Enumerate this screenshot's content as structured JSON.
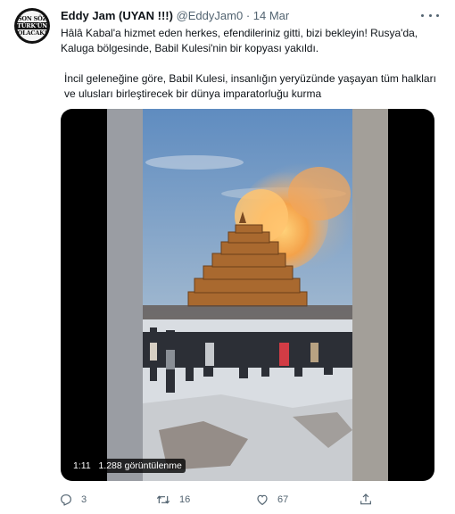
{
  "author": {
    "name": "Eddy Jam (UYAN !!!)",
    "handle": "@EddyJam0",
    "separator": "·",
    "date": "14 Mar",
    "avatar_text": [
      "SON SÖZ",
      "TÜRK'ÜN",
      "OLACAK!"
    ]
  },
  "tweet": {
    "paragraphs": [
      "Hâlâ Kabal'a hizmet eden herkes, efendileriniz gitti, bizi bekleyin! Rusya'da, Kaluga bölgesinde, Babil Kulesi'nin bir kopyası yakıldı.",
      "İncil geleneğine göre, Babil Kulesi, insanlığın yeryüzünde yaşayan tüm halkları ve ulusları birleştirecek bir dünya imparatorluğu kurma"
    ]
  },
  "video": {
    "duration": "1:11",
    "views": "1.288 görüntülenme"
  },
  "actions": {
    "replies": "3",
    "retweets": "16",
    "likes": "67"
  },
  "icons": [
    "more-icon",
    "reply-icon",
    "retweet-icon",
    "like-icon",
    "share-icon"
  ],
  "colors": {
    "text": "#0f1419",
    "secondary": "#536471"
  }
}
